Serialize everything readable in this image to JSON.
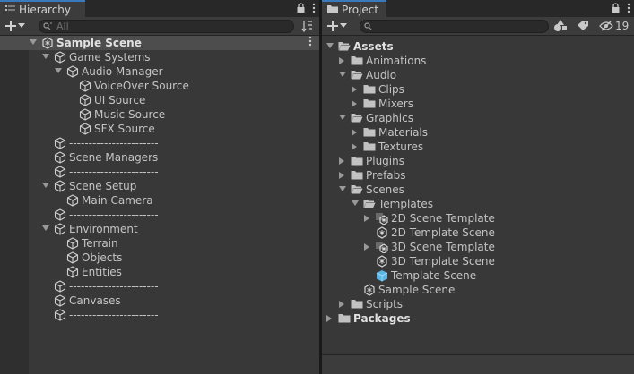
{
  "hierarchy": {
    "tab_label": "Hierarchy",
    "search_placeholder": "All",
    "scene_label": "Sample Scene",
    "items": [
      {
        "label": "Game Systems"
      },
      {
        "label": "Audio Manager"
      },
      {
        "label": "VoiceOver Source"
      },
      {
        "label": "UI Source"
      },
      {
        "label": "Music Source"
      },
      {
        "label": "SFX Source"
      },
      {
        "label": "-----------------------"
      },
      {
        "label": "Scene Managers"
      },
      {
        "label": "-----------------------"
      },
      {
        "label": "Scene Setup"
      },
      {
        "label": "Main Camera"
      },
      {
        "label": "-----------------------"
      },
      {
        "label": "Environment"
      },
      {
        "label": "Terrain"
      },
      {
        "label": "Objects"
      },
      {
        "label": "Entities"
      },
      {
        "label": "-----------------------"
      },
      {
        "label": "Canvases"
      },
      {
        "label": "-----------------------"
      }
    ]
  },
  "project": {
    "tab_label": "Project",
    "hidden_count": "19",
    "items": [
      {
        "label": "Assets"
      },
      {
        "label": "Animations"
      },
      {
        "label": "Audio"
      },
      {
        "label": "Clips"
      },
      {
        "label": "Mixers"
      },
      {
        "label": "Graphics"
      },
      {
        "label": "Materials"
      },
      {
        "label": "Textures"
      },
      {
        "label": "Plugins"
      },
      {
        "label": "Prefabs"
      },
      {
        "label": "Scenes"
      },
      {
        "label": "Templates"
      },
      {
        "label": "2D Scene Template"
      },
      {
        "label": "2D Template Scene"
      },
      {
        "label": "3D Scene Template"
      },
      {
        "label": "3D Template Scene"
      },
      {
        "label": "Template Scene"
      },
      {
        "label": "Sample Scene"
      },
      {
        "label": "Scripts"
      },
      {
        "label": "Packages"
      }
    ]
  },
  "colors": {
    "accent": "#3a79bb",
    "panel": "#383838",
    "selected_row": "#4d4d4d",
    "text": "#c4c4c4"
  },
  "icons": {
    "hierarchy_tab": "list-icon",
    "project_tab": "folder-icon",
    "lock": "lock-icon",
    "menu": "kebab-icon",
    "sort": "sort-icon",
    "search": "search-icon",
    "scene": "unity-scene-icon",
    "gameobject": "cube-icon",
    "folder": "folder-icon",
    "open_folder": "open-folder-icon",
    "scene_template": "scene-template-icon",
    "prefab": "prefab-icon",
    "hidden": "eye-slash-icon",
    "label": "tag-icon",
    "filter": "shapes-icon"
  }
}
